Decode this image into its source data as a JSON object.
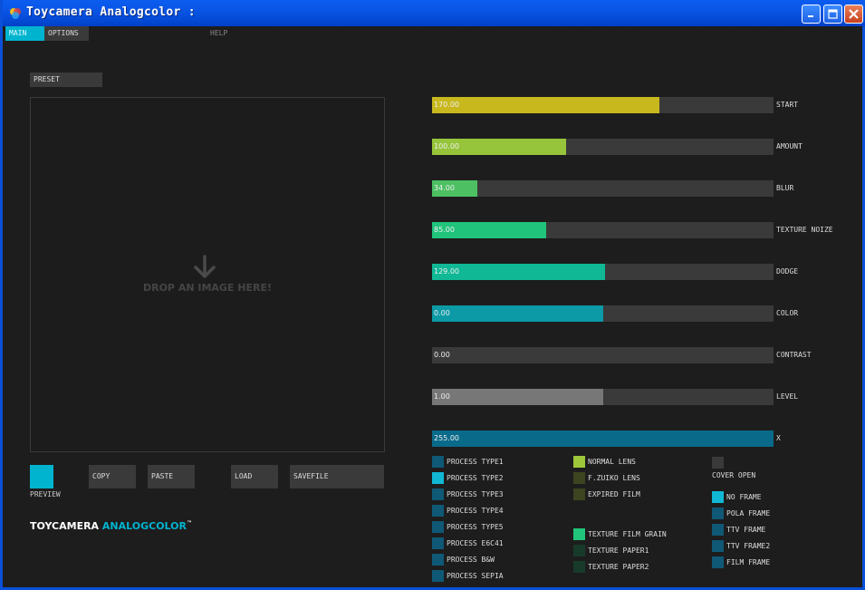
{
  "window": {
    "title": "Toycamera Analogcolor :"
  },
  "menu": {
    "main": "MAIN",
    "options": "OPTIONS",
    "help": "HELP"
  },
  "preset_label": "PRESET",
  "dropzone": {
    "text": "DROP AN IMAGE HERE!",
    "icon": "down-arrow-icon"
  },
  "bottom": {
    "preview": "PREVIEW",
    "copy": "COPY",
    "paste": "PASTE",
    "load": "LOAD",
    "savefile": "SAVEFILE"
  },
  "logo": {
    "part1": "TOYCAMERA ",
    "part2": "ANALOGCOLOR",
    "tm": "™"
  },
  "sliders": [
    {
      "label": "START",
      "value": "170.00",
      "fraction": 0.667,
      "color": "#c8b81e"
    },
    {
      "label": "AMOUNT",
      "value": "100.00",
      "fraction": 0.392,
      "color": "#96c43a"
    },
    {
      "label": "BLUR",
      "value": "34.00",
      "fraction": 0.133,
      "color": "#4cc062"
    },
    {
      "label": "TEXTURE NOIZE",
      "value": "85.00",
      "fraction": 0.333,
      "color": "#20c47a"
    },
    {
      "label": "DODGE",
      "value": "129.00",
      "fraction": 0.506,
      "color": "#10b896"
    },
    {
      "label": "COLOR",
      "value": "0.00",
      "fraction": 0.5,
      "color": "#0b9aa6"
    },
    {
      "label": "CONTRAST",
      "value": "0.00",
      "fraction": 0.0,
      "color": "#3a3a3a"
    },
    {
      "label": "LEVEL",
      "value": "1.00",
      "fraction": 0.5,
      "color": "#777777"
    },
    {
      "label": "X",
      "value": "255.00",
      "fraction": 1.0,
      "color": "#0a6a8a"
    }
  ],
  "process_types": [
    {
      "label": "PROCESS TYPE1",
      "selected": false
    },
    {
      "label": "PROCESS TYPE2",
      "selected": true
    },
    {
      "label": "PROCESS TYPE3",
      "selected": false
    },
    {
      "label": "PROCESS TYPE4",
      "selected": false
    },
    {
      "label": "PROCESS TYPE5",
      "selected": false
    },
    {
      "label": "PROCESS E6C41",
      "selected": false
    },
    {
      "label": "PROCESS B&W",
      "selected": false
    },
    {
      "label": "PROCESS SEPIA",
      "selected": false
    }
  ],
  "lenses": [
    {
      "label": "NORMAL LENS",
      "selected": true
    },
    {
      "label": "F.ZUIKO LENS",
      "selected": false
    },
    {
      "label": "EXPIRED FILM",
      "selected": false
    }
  ],
  "textures": [
    {
      "label": "TEXTURE FILM GRAIN",
      "selected": true
    },
    {
      "label": "TEXTURE PAPER1",
      "selected": false
    },
    {
      "label": "TEXTURE PAPER2",
      "selected": false
    }
  ],
  "cover_open": "COVER OPEN",
  "frames": [
    {
      "label": "NO FRAME",
      "selected": true
    },
    {
      "label": "POLA FRAME",
      "selected": false
    },
    {
      "label": "TTV FRAME",
      "selected": false
    },
    {
      "label": "TTV FRAME2",
      "selected": false
    },
    {
      "label": "FILM FRAME",
      "selected": false
    }
  ],
  "colors": {
    "accent": "#00b4d0",
    "process_off": "#0f5876",
    "process_on": "#10b8d4",
    "lens_on": "#9ec83a",
    "lens_off": "#3c4420",
    "texture_on": "#20c47a",
    "texture_off": "#183a2a",
    "frame_on": "#10b8d4",
    "frame_off": "#0f5876"
  }
}
